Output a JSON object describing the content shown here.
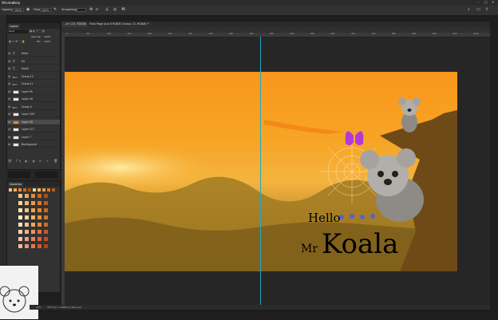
{
  "menubar": {
    "items": [
      "Window",
      "Help"
    ]
  },
  "options": {
    "opacity_label": "Opacity:",
    "opacity_value": "100%",
    "flow_label": "Flow:",
    "flow_value": "100%",
    "smoothing_label": "Smoothing:",
    "angle_value": "0°"
  },
  "layers_panel": {
    "tab": "Layers",
    "kind_label": "Kind",
    "opacity_label": "Opacity:",
    "opacity_value": "100%",
    "fill_label": "Fill:",
    "fill_value": "100%",
    "layers": [
      {
        "name": "Hello",
        "type": "text"
      },
      {
        "name": "Mr",
        "type": "text"
      },
      {
        "name": "Koala",
        "type": "text"
      },
      {
        "name": "Group 12",
        "type": "group"
      },
      {
        "name": "Group 11",
        "type": "group"
      },
      {
        "name": "Layer 95",
        "type": "pixel"
      },
      {
        "name": "Layer 16",
        "type": "pixel"
      },
      {
        "name": "Group 5",
        "type": "group"
      },
      {
        "name": "Layer 105",
        "type": "pixel"
      },
      {
        "name": "Layer 4H",
        "type": "pixel",
        "selected": true
      },
      {
        "name": "Layer 117",
        "type": "pixel"
      },
      {
        "name": "Layer 7",
        "type": "pixel"
      },
      {
        "name": "Background",
        "type": "pixel"
      }
    ]
  },
  "swatches_panel": {
    "tab": "Swatches",
    "colors": [
      "#f4c77a",
      "#f0a84a",
      "#e8873a",
      "#c96a22",
      "#a95013",
      "#f7d89c",
      "#f3b865",
      "#ec9a45",
      "#d97a2c",
      "#b8601b",
      "#fbe3b3",
      "#f6c27c",
      "#ef9f50",
      "#e3862f",
      "#c66a1d",
      "#fdecc9",
      "#f9d298",
      "#f3b268",
      "#ea9140",
      "#d27425",
      "#fde3c2",
      "#f8c18d",
      "#f1a262",
      "#e58641",
      "#cb6b2a",
      "#fbd3b5",
      "#f5b08a",
      "#ee9160",
      "#e07340",
      "#c55a28",
      "#f9c5a6",
      "#f29f7d",
      "#ea8257",
      "#d9653a",
      "#bb4e25",
      "#f7b99a",
      "#ee9470",
      "#e4784d",
      "#cf5d33",
      "#ad4620"
    ]
  },
  "document": {
    "tabs": [
      "...er 123, RGB/8) *",
      "Final Page pub 8 RGB/8 (Group 13, RGB/8) *"
    ],
    "ruler_ticks": [
      "0",
      "50",
      "100",
      "150",
      "200",
      "250",
      "300",
      "350",
      "400",
      "450",
      "500",
      "550",
      "600",
      "650",
      "700",
      "750",
      "800",
      "850",
      "900",
      "950",
      "1000"
    ],
    "zoom": "40%",
    "doc_size": "3375 px x 1688 px (300 ppi)"
  },
  "artwork": {
    "line1": "Hello",
    "line2_a": "Mr",
    "line2_b": "Koala"
  },
  "colors": {
    "sky_top": "#f79a1e",
    "sky_mid": "#f4b33a",
    "ground": "#8f6f22",
    "guide": "#1fa9c7"
  }
}
